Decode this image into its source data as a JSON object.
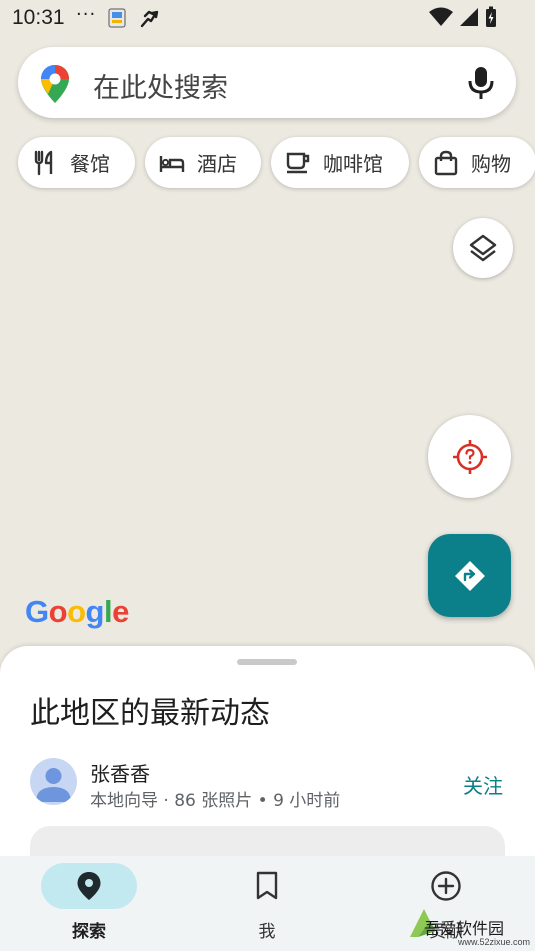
{
  "status_bar": {
    "time": "10:31",
    "dots": "···"
  },
  "search": {
    "placeholder": "在此处搜索"
  },
  "chips": [
    {
      "label": "餐馆",
      "icon": "restaurant-icon"
    },
    {
      "label": "酒店",
      "icon": "hotel-icon"
    },
    {
      "label": "咖啡馆",
      "icon": "coffee-icon"
    },
    {
      "label": "购物",
      "icon": "shopping-bag-icon"
    }
  ],
  "map": {
    "logo_text": "Google"
  },
  "sheet": {
    "heading": "此地区的最新动态",
    "user": {
      "name": "张香香",
      "meta": "本地向导 · 86 张照片 • 9 小时前"
    },
    "follow_label": "关注"
  },
  "nav": {
    "explore": "探索",
    "me": "我",
    "contribute": "贡献"
  },
  "watermark": {
    "text": "吾爱软件园",
    "url": "www.52zixue.com"
  },
  "colors": {
    "accent": "#0B7F8A",
    "map_bg": "#ECE9E1",
    "nav_active": "#C3E9F0",
    "locate_red": "#D93025"
  }
}
